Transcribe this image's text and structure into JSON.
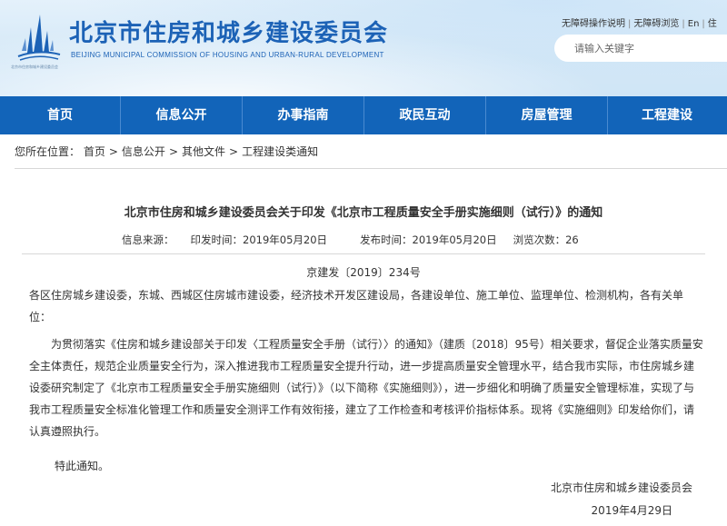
{
  "header": {
    "title": "北京市住房和城乡建设委员会",
    "subtitle": "BEIJING MUNICIPAL COMMISSION OF HOUSING AND URBAN-RURAL DEVELOPMENT",
    "logo_caption": "北京市住房和城乡建设委员会",
    "utility_links": [
      "无障碍操作说明",
      "无障碍浏览",
      "En",
      "住"
    ],
    "search_placeholder": "请输入关键字"
  },
  "nav": [
    "首页",
    "信息公开",
    "办事指南",
    "政民互动",
    "房屋管理",
    "工程建设"
  ],
  "breadcrumb": {
    "prefix": "您所在位置：",
    "items": [
      "首页",
      "信息公开",
      "其他文件",
      "工程建设类通知"
    ]
  },
  "article": {
    "title": "北京市住房和城乡建设委员会关于印发《北京市工程质量安全手册实施细则（试行）》的通知",
    "meta": {
      "source_label": "信息来源：",
      "source_value": "",
      "issue_label": "印发时间：",
      "issue_value": "2019年05月20日",
      "publish_label": "发布时间：",
      "publish_value": "2019年05月20日",
      "views_label": "浏览次数：",
      "views_value": "26"
    },
    "doc_number": "京建发〔2019〕234号",
    "paragraphs": [
      "各区住房城乡建设委，东城、西城区住房城市建设委，经济技术开发区建设局，各建设单位、施工单位、监理单位、检测机构，各有关单位：",
      "为贯彻落实《住房和城乡建设部关于印发〈工程质量安全手册（试行）〉的通知》（建质〔2018〕95号）相关要求，督促企业落实质量安全主体责任，规范企业质量安全行为，深入推进我市工程质量安全提升行动，进一步提高质量安全管理水平，结合我市实际，市住房城乡建设委研究制定了《北京市工程质量安全手册实施细则（试行）》（以下简称《实施细则》），进一步细化和明确了质量安全管理标准，实现了与我市工程质量安全标准化管理工作和质量安全测评工作有效衔接，建立了工作检查和考核评价指标体系。现将《实施细则》印发给你们，请认真遵照执行。",
      "特此通知。"
    ],
    "signature_org": "北京市住房和城乡建设委员会",
    "signature_date": "2019年4月29日"
  },
  "colors": {
    "brand_blue": "#1c62b6",
    "nav_blue": "#1264b9"
  }
}
